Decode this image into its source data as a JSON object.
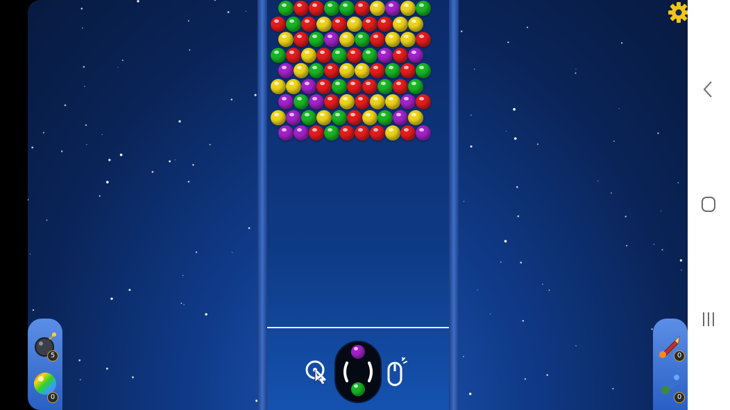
{
  "colors": {
    "red": "#e21d1d",
    "green": "#18b424",
    "yellow": "#ecd21a",
    "purple": "#a222c8",
    "accent_gear": "#f2c319"
  },
  "board": {
    "rows": [
      [
        "green",
        "red",
        "red",
        "green",
        "green",
        "red",
        "yellow",
        "purple",
        "yellow",
        "green"
      ],
      [
        "red",
        "green",
        "red",
        "yellow",
        "red",
        "yellow",
        "red",
        "red",
        "yellow",
        "yellow"
      ],
      [
        "yellow",
        "red",
        "green",
        "purple",
        "yellow",
        "green",
        "red",
        "yellow",
        "yellow",
        "red"
      ],
      [
        "green",
        "red",
        "yellow",
        "red",
        "green",
        "red",
        "green",
        "purple",
        "red",
        "purple"
      ],
      [
        "purple",
        "yellow",
        "green",
        "red",
        "yellow",
        "yellow",
        "red",
        "green",
        "red",
        "green"
      ],
      [
        "yellow",
        "yellow",
        "purple",
        "red",
        "green",
        "red",
        "red",
        "green",
        "red",
        "green"
      ],
      [
        "purple",
        "green",
        "purple",
        "red",
        "yellow",
        "red",
        "yellow",
        "yellow",
        "purple",
        "red"
      ],
      [
        "yellow",
        "purple",
        "green",
        "yellow",
        "green",
        "red",
        "yellow",
        "green",
        "purple",
        "yellow"
      ],
      [
        "purple",
        "purple",
        "red",
        "green",
        "red",
        "red",
        "red",
        "yellow",
        "red",
        "purple"
      ]
    ]
  },
  "launcher": {
    "next_bubble": "purple",
    "current_bubble": "green"
  },
  "controls": {
    "aim_icon": "aim-cursor-icon",
    "mouse_icon": "mouse-icon"
  },
  "powerups_left": [
    {
      "name": "bomb-icon",
      "count": "5"
    },
    {
      "name": "rainbow-ball-icon",
      "count": "0"
    }
  ],
  "powerups_right": [
    {
      "name": "fire-rocket-icon",
      "count": "0"
    },
    {
      "name": "cannon-icon",
      "count": "0"
    }
  ],
  "settings": {
    "icon": "gear-icon"
  },
  "navbar": {
    "buttons": [
      "back-icon",
      "home-icon",
      "recents-icon"
    ]
  }
}
